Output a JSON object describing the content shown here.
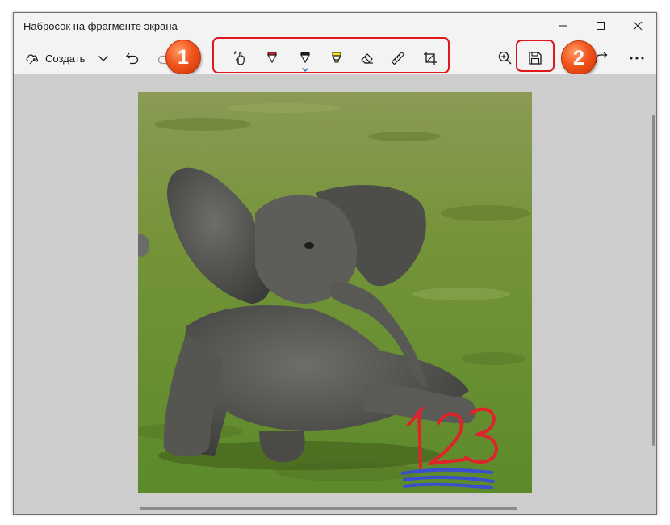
{
  "window": {
    "title": "Набросок на фрагменте экрана"
  },
  "titlebar_buttons": {
    "minimize_icon": "minimize-icon",
    "maximize_icon": "maximize-icon",
    "close_icon": "close-icon"
  },
  "toolbar": {
    "create_label": "Создать",
    "create_icon": "new-snip-icon",
    "dropdown_icon": "chevron-down-icon",
    "undo_icon": "undo-icon",
    "pen_tools": [
      {
        "name": "touch-writing-icon"
      },
      {
        "name": "ballpoint-pen-icon",
        "color": "#e0232b"
      },
      {
        "name": "pencil-icon",
        "color": "#1a1a1a",
        "selected": true
      },
      {
        "name": "highlighter-icon",
        "color": "#f5e21b"
      },
      {
        "name": "eraser-icon"
      },
      {
        "name": "ruler-icon"
      },
      {
        "name": "crop-icon"
      }
    ],
    "zoom_icon": "zoom-in-icon",
    "save_icon": "save-icon",
    "share_icon": "share-icon",
    "more_icon": "more-options-icon"
  },
  "annotations": {
    "badge1": "1",
    "badge2": "2",
    "accent": "#e0171b",
    "badge_color": "#f2541b"
  },
  "canvas": {
    "image_subject": "baby elephant sitting on grass",
    "handwritten_text": "123",
    "handwriting_color": "#e0232b",
    "underline_color": "#3a4fd0"
  }
}
